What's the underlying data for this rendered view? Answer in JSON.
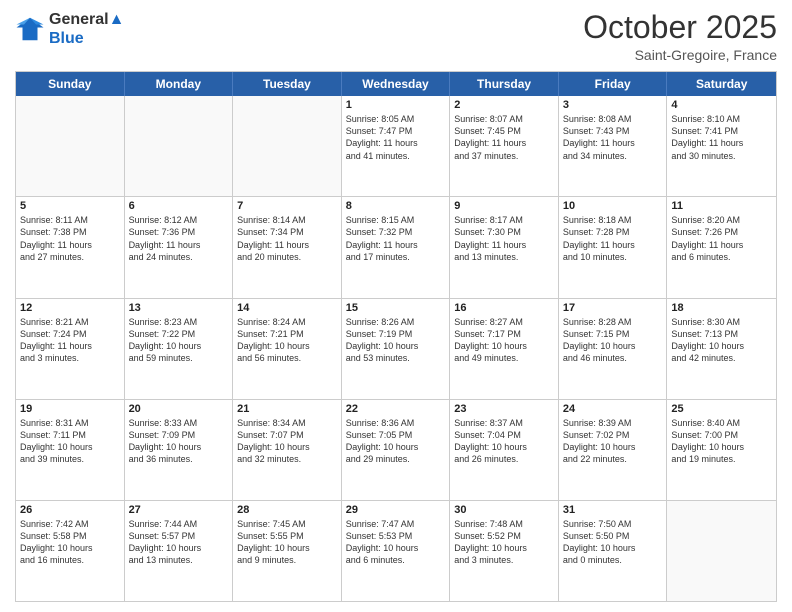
{
  "header": {
    "logo_line1": "General",
    "logo_line2": "Blue",
    "month": "October 2025",
    "location": "Saint-Gregoire, France"
  },
  "weekdays": [
    "Sunday",
    "Monday",
    "Tuesday",
    "Wednesday",
    "Thursday",
    "Friday",
    "Saturday"
  ],
  "rows": [
    [
      {
        "day": "",
        "text": ""
      },
      {
        "day": "",
        "text": ""
      },
      {
        "day": "",
        "text": ""
      },
      {
        "day": "1",
        "text": "Sunrise: 8:05 AM\nSunset: 7:47 PM\nDaylight: 11 hours\nand 41 minutes."
      },
      {
        "day": "2",
        "text": "Sunrise: 8:07 AM\nSunset: 7:45 PM\nDaylight: 11 hours\nand 37 minutes."
      },
      {
        "day": "3",
        "text": "Sunrise: 8:08 AM\nSunset: 7:43 PM\nDaylight: 11 hours\nand 34 minutes."
      },
      {
        "day": "4",
        "text": "Sunrise: 8:10 AM\nSunset: 7:41 PM\nDaylight: 11 hours\nand 30 minutes."
      }
    ],
    [
      {
        "day": "5",
        "text": "Sunrise: 8:11 AM\nSunset: 7:38 PM\nDaylight: 11 hours\nand 27 minutes."
      },
      {
        "day": "6",
        "text": "Sunrise: 8:12 AM\nSunset: 7:36 PM\nDaylight: 11 hours\nand 24 minutes."
      },
      {
        "day": "7",
        "text": "Sunrise: 8:14 AM\nSunset: 7:34 PM\nDaylight: 11 hours\nand 20 minutes."
      },
      {
        "day": "8",
        "text": "Sunrise: 8:15 AM\nSunset: 7:32 PM\nDaylight: 11 hours\nand 17 minutes."
      },
      {
        "day": "9",
        "text": "Sunrise: 8:17 AM\nSunset: 7:30 PM\nDaylight: 11 hours\nand 13 minutes."
      },
      {
        "day": "10",
        "text": "Sunrise: 8:18 AM\nSunset: 7:28 PM\nDaylight: 11 hours\nand 10 minutes."
      },
      {
        "day": "11",
        "text": "Sunrise: 8:20 AM\nSunset: 7:26 PM\nDaylight: 11 hours\nand 6 minutes."
      }
    ],
    [
      {
        "day": "12",
        "text": "Sunrise: 8:21 AM\nSunset: 7:24 PM\nDaylight: 11 hours\nand 3 minutes."
      },
      {
        "day": "13",
        "text": "Sunrise: 8:23 AM\nSunset: 7:22 PM\nDaylight: 10 hours\nand 59 minutes."
      },
      {
        "day": "14",
        "text": "Sunrise: 8:24 AM\nSunset: 7:21 PM\nDaylight: 10 hours\nand 56 minutes."
      },
      {
        "day": "15",
        "text": "Sunrise: 8:26 AM\nSunset: 7:19 PM\nDaylight: 10 hours\nand 53 minutes."
      },
      {
        "day": "16",
        "text": "Sunrise: 8:27 AM\nSunset: 7:17 PM\nDaylight: 10 hours\nand 49 minutes."
      },
      {
        "day": "17",
        "text": "Sunrise: 8:28 AM\nSunset: 7:15 PM\nDaylight: 10 hours\nand 46 minutes."
      },
      {
        "day": "18",
        "text": "Sunrise: 8:30 AM\nSunset: 7:13 PM\nDaylight: 10 hours\nand 42 minutes."
      }
    ],
    [
      {
        "day": "19",
        "text": "Sunrise: 8:31 AM\nSunset: 7:11 PM\nDaylight: 10 hours\nand 39 minutes."
      },
      {
        "day": "20",
        "text": "Sunrise: 8:33 AM\nSunset: 7:09 PM\nDaylight: 10 hours\nand 36 minutes."
      },
      {
        "day": "21",
        "text": "Sunrise: 8:34 AM\nSunset: 7:07 PM\nDaylight: 10 hours\nand 32 minutes."
      },
      {
        "day": "22",
        "text": "Sunrise: 8:36 AM\nSunset: 7:05 PM\nDaylight: 10 hours\nand 29 minutes."
      },
      {
        "day": "23",
        "text": "Sunrise: 8:37 AM\nSunset: 7:04 PM\nDaylight: 10 hours\nand 26 minutes."
      },
      {
        "day": "24",
        "text": "Sunrise: 8:39 AM\nSunset: 7:02 PM\nDaylight: 10 hours\nand 22 minutes."
      },
      {
        "day": "25",
        "text": "Sunrise: 8:40 AM\nSunset: 7:00 PM\nDaylight: 10 hours\nand 19 minutes."
      }
    ],
    [
      {
        "day": "26",
        "text": "Sunrise: 7:42 AM\nSunset: 5:58 PM\nDaylight: 10 hours\nand 16 minutes."
      },
      {
        "day": "27",
        "text": "Sunrise: 7:44 AM\nSunset: 5:57 PM\nDaylight: 10 hours\nand 13 minutes."
      },
      {
        "day": "28",
        "text": "Sunrise: 7:45 AM\nSunset: 5:55 PM\nDaylight: 10 hours\nand 9 minutes."
      },
      {
        "day": "29",
        "text": "Sunrise: 7:47 AM\nSunset: 5:53 PM\nDaylight: 10 hours\nand 6 minutes."
      },
      {
        "day": "30",
        "text": "Sunrise: 7:48 AM\nSunset: 5:52 PM\nDaylight: 10 hours\nand 3 minutes."
      },
      {
        "day": "31",
        "text": "Sunrise: 7:50 AM\nSunset: 5:50 PM\nDaylight: 10 hours\nand 0 minutes."
      },
      {
        "day": "",
        "text": ""
      }
    ]
  ]
}
